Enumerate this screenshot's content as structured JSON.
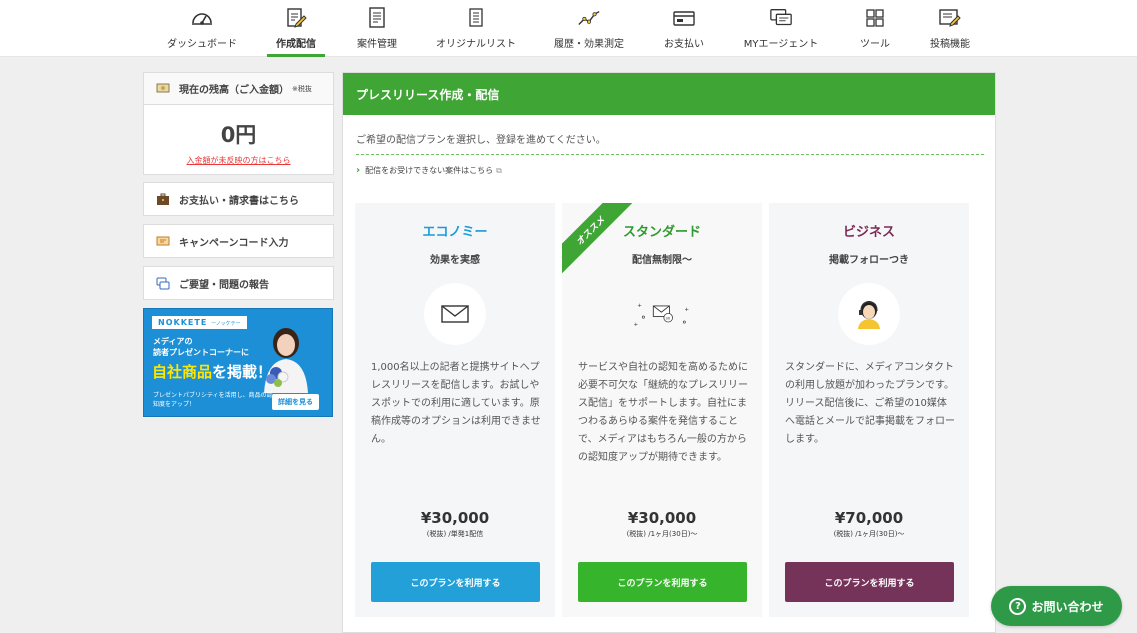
{
  "nav": [
    {
      "label": "ダッシュボード",
      "icon": "gauge-icon"
    },
    {
      "label": "作成配信",
      "icon": "edit-document-icon",
      "active": true
    },
    {
      "label": "案件管理",
      "icon": "document-list-icon"
    },
    {
      "label": "オリジナルリスト",
      "icon": "list-icon"
    },
    {
      "label": "履歴・効果測定",
      "icon": "line-chart-icon"
    },
    {
      "label": "お支払い",
      "icon": "payment-card-icon"
    },
    {
      "label": "MYエージェント",
      "icon": "chat-bubbles-icon"
    },
    {
      "label": "ツール",
      "icon": "grid-icon"
    },
    {
      "label": "投稿機能",
      "icon": "post-edit-icon"
    }
  ],
  "sidebar": {
    "balance_title": "現在の残高（ご入金額）",
    "balance_note": "※税抜",
    "balance_amount": "0円",
    "balance_link": "入金額が未反映の方はこちら",
    "payment": "お支払い・請求書はこちら",
    "campaign": "キャンペーンコード入力",
    "feedback": "ご要望・問題の報告",
    "banner": {
      "brand": "NOKKETE",
      "brand_sub": "ーノッケテー",
      "line1": "メディアの",
      "line2": "読者プレゼントコーナーに",
      "line3a": "自社商品",
      "line3b": "を掲載！",
      "line4": "プレゼントパブリシティを活用し、商品の認知度をアップ！",
      "cta": "詳細を見る"
    }
  },
  "main": {
    "title": "プレスリリース作成・配信",
    "intro": "ご希望の配信プランを選択し、登録を進めてください。",
    "notice": "配信をお受けできない案件はこちら",
    "ribbon": "オススメ",
    "plans": [
      {
        "name": "エコノミー",
        "subtitle": "効果を実感",
        "desc": "1,000名以上の記者と提携サイトへプレスリリースを配信します。お試しやスポットでの利用に適しています。原稿作成等のオプションは利用できません。",
        "price": "¥30,000",
        "note": "(税抜) /単発1配信",
        "button": "このプランを利用する",
        "color": "#1b9bd7",
        "btn_color": "#23a0d8"
      },
      {
        "name": "スタンダード",
        "subtitle": "配信無制限〜",
        "desc": "サービスや自社の認知を高めるために必要不可欠な「継続的なプレスリリース配信」をサポートします。自社にまつわるあらゆる案件を発信することで、メディアはもちろん一般の方からの認知度アップが期待できます。",
        "price": "¥30,000",
        "note": "(税抜) /1ヶ月(30日)〜",
        "button": "このプランを利用する",
        "color": "#2e9a2e",
        "btn_color": "#36b52c"
      },
      {
        "name": "ビジネス",
        "subtitle": "掲載フォローつき",
        "desc": "スタンダードに、メディアコンタクトの利用し放題が加わったプランです。リリース配信後に、ご希望の10媒体へ電話とメールで記事掲載をフォローします。",
        "price": "¥70,000",
        "note": "(税抜) /1ヶ月(30日)〜",
        "button": "このプランを利用する",
        "color": "#7a2a55",
        "btn_color": "#76335a"
      }
    ]
  },
  "contact": {
    "label": "お問い合わせ",
    "icon_char": "?"
  },
  "colors": {
    "brand_green": "#3fa535",
    "link_red": "#e83a3a"
  }
}
